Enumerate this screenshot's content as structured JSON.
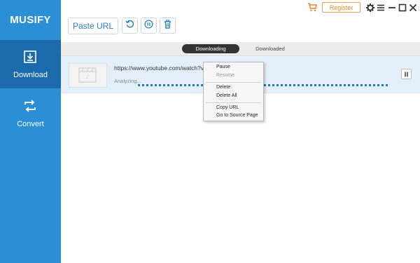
{
  "sidebar": {
    "brand": "MUSIFY",
    "items": [
      {
        "label": "Download",
        "icon": "download-icon",
        "active": true
      },
      {
        "label": "Convert",
        "icon": "convert-icon",
        "active": false
      }
    ]
  },
  "toolbar": {
    "paste_url_label": "Paste URL",
    "buttons": [
      "refresh-icon",
      "pause-all-icon",
      "trash-icon"
    ]
  },
  "header": {
    "register_label": "Register",
    "icons": [
      "cart-icon",
      "gear-icon",
      "menu-icon",
      "minimize-icon",
      "maximize-icon",
      "close-icon"
    ]
  },
  "tabs": [
    {
      "label": "Downloading",
      "active": true
    },
    {
      "label": "Downloaded",
      "active": false
    }
  ],
  "download": {
    "url": "https://www.youtube.com/watch?v=",
    "status": "Analyzing..."
  },
  "context_menu": {
    "items": [
      {
        "label": "Pause",
        "enabled": true
      },
      {
        "label": "Resume",
        "enabled": false
      },
      {
        "label": "Delete",
        "enabled": true
      },
      {
        "label": "Delete All",
        "enabled": true
      },
      {
        "label": "Copy URL",
        "enabled": true
      },
      {
        "label": "Go to Source Page",
        "enabled": true
      }
    ]
  },
  "colors": {
    "sidebar": "#2b8fd6",
    "sidebar_active": "#1b6aab",
    "accent": "#1b7bc4",
    "register": "#e6862a"
  }
}
